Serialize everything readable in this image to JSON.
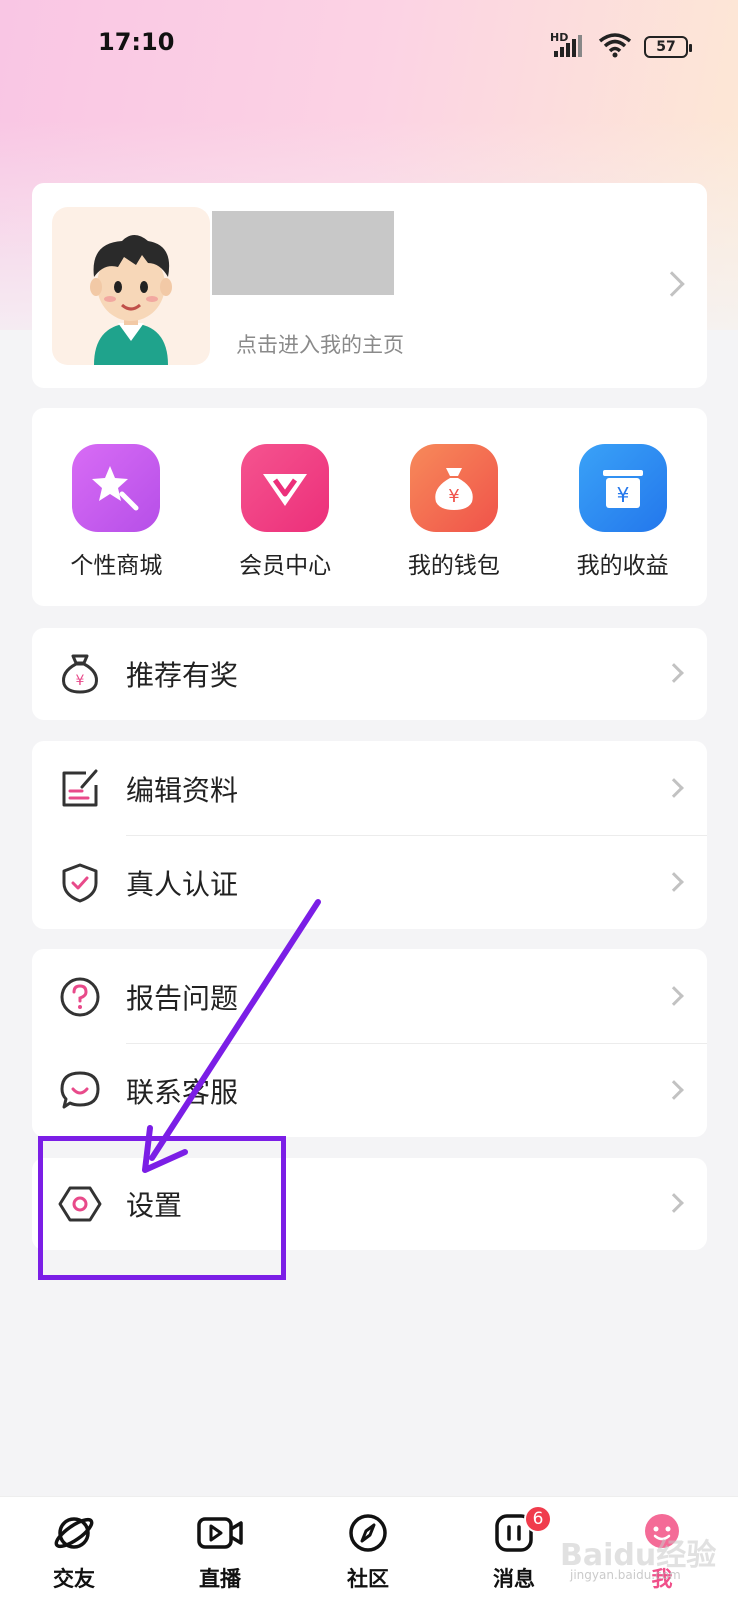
{
  "status_bar": {
    "time": "17:10",
    "network": "HD",
    "battery": "57"
  },
  "profile": {
    "hint": "点击进入我的主页"
  },
  "shortcuts": [
    {
      "label": "个性商城",
      "icon": "star-wand-icon",
      "color": "#c95cf0"
    },
    {
      "label": "会员中心",
      "icon": "diamond-v-icon",
      "color": "#f23f8e"
    },
    {
      "label": "我的钱包",
      "icon": "money-bag-icon",
      "color": "#f56a4e"
    },
    {
      "label": "我的收益",
      "icon": "income-box-icon",
      "color": "#2f8cf2"
    }
  ],
  "menu": {
    "referral": "推荐有奖",
    "edit_profile": "编辑资料",
    "verify": "真人认证",
    "report": "报告问题",
    "support": "联系客服",
    "settings": "设置"
  },
  "bottom_nav": [
    {
      "label": "交友",
      "icon": "planet-icon"
    },
    {
      "label": "直播",
      "icon": "video-icon"
    },
    {
      "label": "社区",
      "icon": "compass-icon"
    },
    {
      "label": "消息",
      "icon": "message-icon",
      "badge": "6"
    },
    {
      "label": "我",
      "icon": "me-avatar-icon"
    }
  ],
  "watermark": {
    "text": "Baidu经验",
    "sub": "jingyan.baidu.com"
  },
  "annotation_color": "#7b1ee6"
}
